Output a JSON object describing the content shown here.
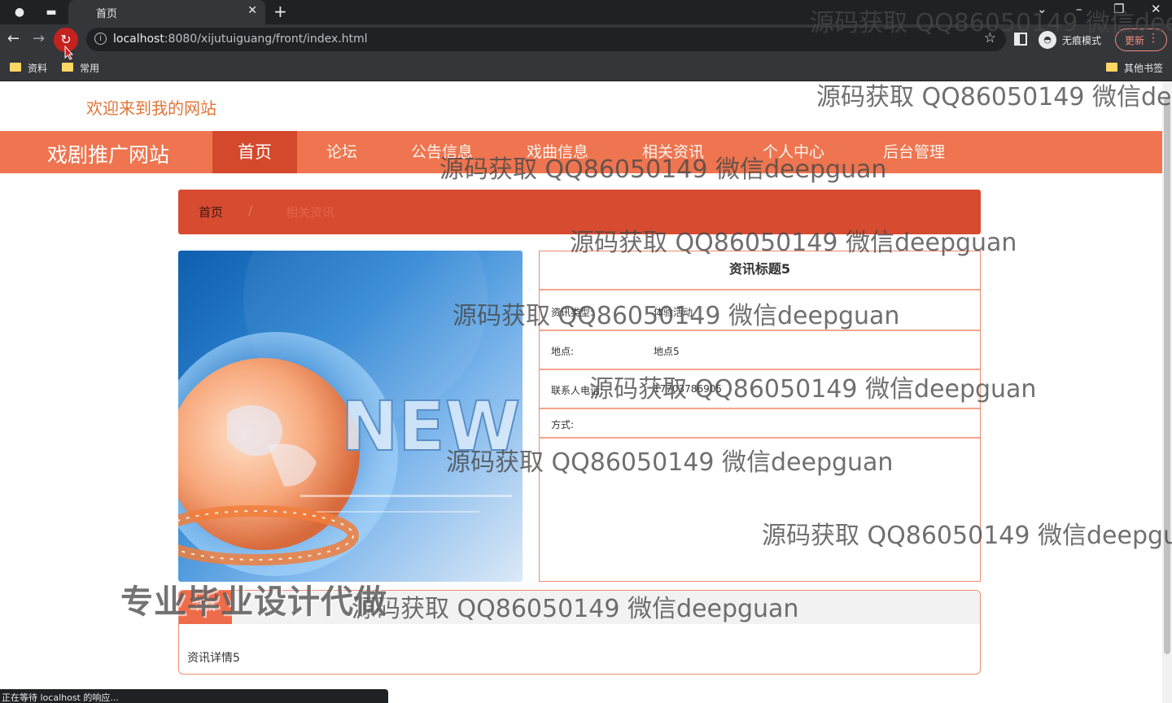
{
  "browser": {
    "tab_title": "首页",
    "url_host": "localhost",
    "url_rest": ":8080/xijutuiguang/front/index.html",
    "incognito_label": "无痕模式",
    "update_label": "更新",
    "bookmarks": [
      "资料",
      "常用"
    ],
    "other_bookmarks": "其他书签",
    "status": "正在等待 localhost 的响应..."
  },
  "page": {
    "welcome": "欢迎来到我的网站",
    "site_title": "戏剧推广网站",
    "nav": [
      "首页",
      "论坛",
      "公告信息",
      "戏曲信息",
      "相关资讯",
      "个人中心",
      "后台管理"
    ],
    "breadcrumb": {
      "home": "首页",
      "separator": "/",
      "current": "相关资讯"
    }
  },
  "news": {
    "image_text": "NEW",
    "title": "资讯标题5",
    "fields": [
      {
        "key": "资讯类型:",
        "value": "体验活动"
      },
      {
        "key": "地点:",
        "value": "地点5"
      },
      {
        "key": "联系人电话:",
        "value": "17703786905"
      },
      {
        "key": "方式:",
        "value": ""
      }
    ],
    "detail_tab": "详情",
    "detail_text": "资讯详情5"
  },
  "watermarks": {
    "text_1": "源码获取 QQ86050149 微信dee",
    "text_2": "源码获取 QQ86050149 微信dee",
    "text_3": "源码获取 QQ86050149 微信deepguan",
    "text_4": "源码获取 QQ86050149 微信deepguan",
    "text_5": "源码获取 QQ86050149 微信deepguan",
    "text_6": "源码获取 QQ86050149 微信deepguan",
    "text_7": "源码获取 QQ86050149 微信deepguan",
    "text_8": "源码获取 QQ86050149 微信deepgua",
    "text_9": "源码获取 QQ86050149 微信deepguan",
    "big": "专业毕业设计代做"
  },
  "colors": {
    "accent": "#ee7550",
    "accent_dark": "#d4482b",
    "welcome": "#e27437"
  }
}
